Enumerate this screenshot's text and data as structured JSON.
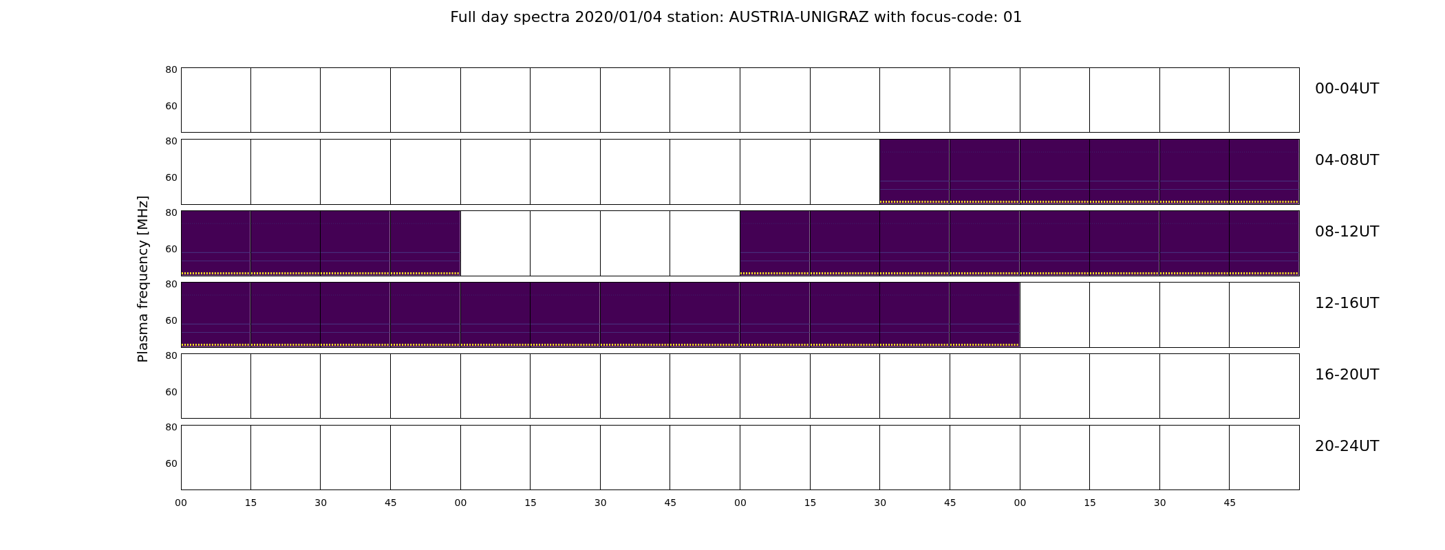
{
  "title": "Full day spectra 2020/01/04 station: AUSTRIA-UNIGRAZ with focus-code: 01",
  "ylabel": "Plasma frequency [MHz]",
  "rows": [
    {
      "label": "00-04UT",
      "yticks": [
        "80",
        "60"
      ],
      "panels": [
        {
          "filled": false
        },
        {
          "filled": false
        },
        {
          "filled": false
        },
        {
          "filled": false
        },
        {
          "filled": false
        },
        {
          "filled": false
        },
        {
          "filled": false
        },
        {
          "filled": false
        },
        {
          "filled": false
        },
        {
          "filled": false
        },
        {
          "filled": false
        },
        {
          "filled": false
        },
        {
          "filled": false
        },
        {
          "filled": false
        },
        {
          "filled": false
        },
        {
          "filled": false
        }
      ]
    },
    {
      "label": "04-08UT",
      "yticks": [
        "80",
        "60"
      ],
      "panels": [
        {
          "filled": false
        },
        {
          "filled": false
        },
        {
          "filled": false
        },
        {
          "filled": false
        },
        {
          "filled": false
        },
        {
          "filled": false
        },
        {
          "filled": false
        },
        {
          "filled": false
        },
        {
          "filled": false
        },
        {
          "filled": false
        },
        {
          "filled": true
        },
        {
          "filled": true
        },
        {
          "filled": true
        },
        {
          "filled": true
        },
        {
          "filled": true
        },
        {
          "filled": true
        }
      ]
    },
    {
      "label": "08-12UT",
      "yticks": [
        "80",
        "60"
      ],
      "panels": [
        {
          "filled": true
        },
        {
          "filled": true
        },
        {
          "filled": true
        },
        {
          "filled": true
        },
        {
          "filled": false
        },
        {
          "filled": false
        },
        {
          "filled": false
        },
        {
          "filled": false
        },
        {
          "filled": true
        },
        {
          "filled": true
        },
        {
          "filled": true
        },
        {
          "filled": true
        },
        {
          "filled": true
        },
        {
          "filled": true
        },
        {
          "filled": true
        },
        {
          "filled": true
        }
      ]
    },
    {
      "label": "12-16UT",
      "yticks": [
        "80",
        "60"
      ],
      "panels": [
        {
          "filled": true
        },
        {
          "filled": true
        },
        {
          "filled": true
        },
        {
          "filled": true
        },
        {
          "filled": true
        },
        {
          "filled": true
        },
        {
          "filled": true
        },
        {
          "filled": true
        },
        {
          "filled": true
        },
        {
          "filled": true
        },
        {
          "filled": true
        },
        {
          "filled": true
        },
        {
          "filled": false
        },
        {
          "filled": false
        },
        {
          "filled": false
        },
        {
          "filled": false
        }
      ]
    },
    {
      "label": "16-20UT",
      "yticks": [
        "80",
        "60"
      ],
      "panels": [
        {
          "filled": false
        },
        {
          "filled": false
        },
        {
          "filled": false
        },
        {
          "filled": false
        },
        {
          "filled": false
        },
        {
          "filled": false
        },
        {
          "filled": false
        },
        {
          "filled": false
        },
        {
          "filled": false
        },
        {
          "filled": false
        },
        {
          "filled": false
        },
        {
          "filled": false
        },
        {
          "filled": false
        },
        {
          "filled": false
        },
        {
          "filled": false
        },
        {
          "filled": false
        }
      ]
    },
    {
      "label": "20-24UT",
      "yticks": [
        "80",
        "60"
      ],
      "panels": [
        {
          "filled": false
        },
        {
          "filled": false
        },
        {
          "filled": false
        },
        {
          "filled": false
        },
        {
          "filled": false
        },
        {
          "filled": false
        },
        {
          "filled": false
        },
        {
          "filled": false
        },
        {
          "filled": false
        },
        {
          "filled": false
        },
        {
          "filled": false
        },
        {
          "filled": false
        },
        {
          "filled": false
        },
        {
          "filled": false
        },
        {
          "filled": false
        },
        {
          "filled": false
        }
      ]
    }
  ],
  "xticks": [
    "00",
    "15",
    "30",
    "45",
    "00",
    "15",
    "30",
    "45",
    "00",
    "15",
    "30",
    "45",
    "00",
    "15",
    "30",
    "45"
  ]
}
